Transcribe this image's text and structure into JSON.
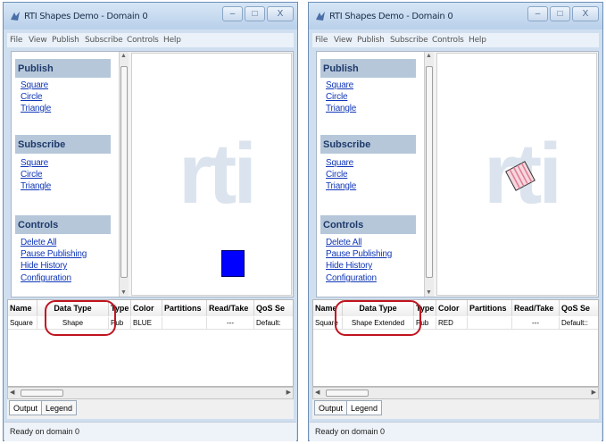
{
  "windows": [
    {
      "title": "RTI Shapes Demo - Domain 0",
      "menu": [
        "File",
        "View",
        "Publish",
        "Subscribe",
        "Controls",
        "Help"
      ],
      "window_controls": {
        "minimize": "–",
        "maximize": "□",
        "close": "X"
      },
      "publish": {
        "header": "Publish",
        "items": [
          "Square",
          "Circle",
          "Triangle"
        ]
      },
      "subscribe": {
        "header": "Subscribe",
        "items": [
          "Square",
          "Circle",
          "Triangle"
        ]
      },
      "controls": {
        "header": "Controls",
        "items": [
          "Delete All",
          "Pause Publishing",
          "Hide History",
          "Configuration"
        ]
      },
      "canvas": {
        "watermark": "rti",
        "shape": "square",
        "shape_color": "#0000ff"
      },
      "table": {
        "columns": [
          "Name",
          "Data Type",
          "Type",
          "Color",
          "Partitions",
          "Read/Take",
          "QoS Se"
        ],
        "rows": [
          [
            "Square",
            "Shape",
            "Pub",
            "BLUE",
            "",
            "---",
            "Default:"
          ]
        ]
      },
      "tabs": [
        "Output",
        "Legend"
      ],
      "status": "Ready on domain 0"
    },
    {
      "title": "RTI Shapes Demo - Domain 0",
      "menu": [
        "File",
        "View",
        "Publish",
        "Subscribe",
        "Controls",
        "Help"
      ],
      "window_controls": {
        "minimize": "–",
        "maximize": "□",
        "close": "X"
      },
      "publish": {
        "header": "Publish",
        "items": [
          "Square",
          "Circle",
          "Triangle"
        ]
      },
      "subscribe": {
        "header": "Subscribe",
        "items": [
          "Square",
          "Circle",
          "Triangle"
        ]
      },
      "controls": {
        "header": "Controls",
        "items": [
          "Delete All",
          "Pause Publishing",
          "Hide History",
          "Configuration"
        ]
      },
      "canvas": {
        "watermark": "rti",
        "shape": "square-rotated-striped",
        "shape_color": "#e8a0b0"
      },
      "table": {
        "columns": [
          "Name",
          "Data Type",
          "Type",
          "Color",
          "Partitions",
          "Read/Take",
          "QoS Se"
        ],
        "rows": [
          [
            "Square",
            "Shape Extended",
            "Pub",
            "RED",
            "",
            "---",
            "Default::"
          ]
        ]
      },
      "tabs": [
        "Output",
        "Legend"
      ],
      "status": "Ready on domain 0"
    }
  ],
  "colors": {
    "highlight_ring": "#c0141f",
    "link": "#1238b8",
    "section_header": "#b6c7da"
  }
}
